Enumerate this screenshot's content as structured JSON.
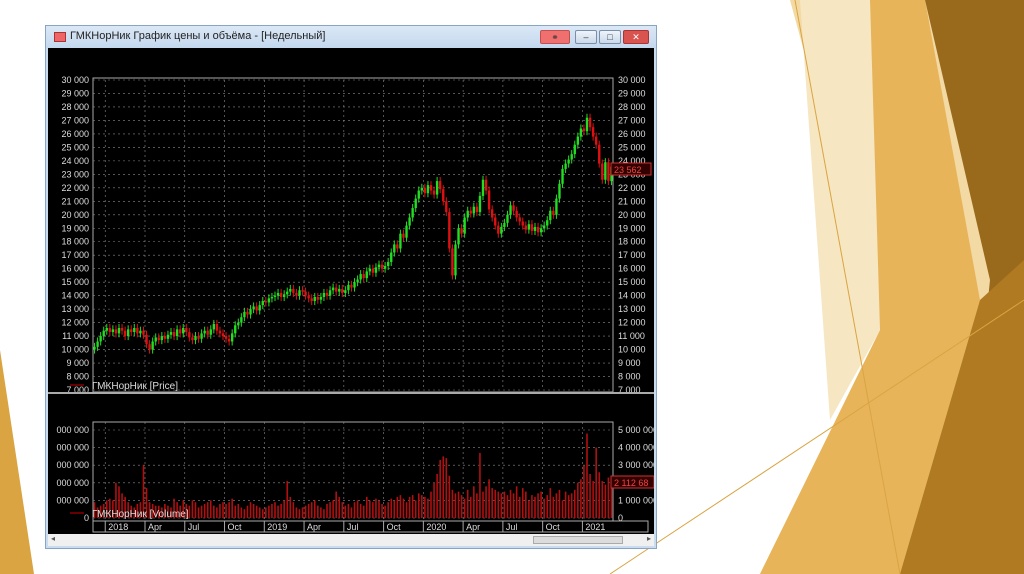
{
  "window": {
    "title": "ГМКНорНик График цены и объёма - [Недельный]",
    "buttons": {
      "link": "link-icon",
      "minimize": "minimize",
      "maximize": "maximize",
      "close": "close"
    }
  },
  "colors": {
    "up": "#22dd22",
    "down": "#dd1111",
    "volume": "#b01010",
    "grid": "#8a8a8a",
    "slide_gold": "#d9a441"
  },
  "price_legend": "ГМКНорНик [Price]",
  "volume_legend": "ГМКНорНик [Volume]",
  "price_last_label": "23 562",
  "volume_last_label": "2 112 68",
  "price_ticks": [
    "7 000",
    "8 000",
    "9 000",
    "10 000",
    "11 000",
    "12 000",
    "13 000",
    "14 000",
    "15 000",
    "16 000",
    "17 000",
    "18 000",
    "19 000",
    "20 000",
    "21 000",
    "22 000",
    "23 000",
    "24 000",
    "25 000",
    "26 000",
    "27 000",
    "28 000",
    "29 000",
    "30 000"
  ],
  "volume_ticks_left": [
    "0",
    "000 000",
    "000 000",
    "000 000",
    "000 000",
    "000 000"
  ],
  "volume_ticks_right": [
    "0",
    "1 000 000",
    "2 000 000",
    "3 000 000",
    "4 000 000",
    "5 000 000"
  ],
  "date_labels": [
    {
      "label": "2018",
      "week": 4
    },
    {
      "label": "Apr",
      "week": 17
    },
    {
      "label": "Jul",
      "week": 30
    },
    {
      "label": "Oct",
      "week": 43
    },
    {
      "label": "2019",
      "week": 56
    },
    {
      "label": "Apr",
      "week": 69
    },
    {
      "label": "Jul",
      "week": 82
    },
    {
      "label": "Oct",
      "week": 95
    },
    {
      "label": "2020",
      "week": 108
    },
    {
      "label": "Apr",
      "week": 121
    },
    {
      "label": "Jul",
      "week": 134
    },
    {
      "label": "Oct",
      "week": 147
    },
    {
      "label": "2021",
      "week": 160
    }
  ],
  "chart_data": [
    {
      "type": "candlestick",
      "interval": "weekly",
      "ylim": [
        7000,
        30000
      ],
      "grid": true,
      "legend": "bottom-left",
      "close": [
        10200,
        10600,
        11000,
        11400,
        11600,
        11300,
        11500,
        11200,
        11600,
        11400,
        11000,
        11500,
        11300,
        11600,
        11200,
        11400,
        11100,
        10400,
        10000,
        10600,
        10900,
        10700,
        11000,
        10800,
        11100,
        11300,
        11000,
        11500,
        11200,
        11600,
        11300,
        10900,
        10700,
        11000,
        10800,
        11200,
        11400,
        11100,
        11500,
        11900,
        11400,
        11200,
        11000,
        10800,
        10600,
        11200,
        11800,
        12000,
        12400,
        12800,
        12600,
        13000,
        13200,
        12900,
        13300,
        13600,
        13500,
        13800,
        13900,
        14000,
        14200,
        13900,
        14100,
        14300,
        14500,
        14200,
        14000,
        14400,
        14300,
        14000,
        13800,
        13600,
        13900,
        13700,
        13900,
        14200,
        14000,
        14400,
        14600,
        14300,
        14500,
        14200,
        14400,
        14800,
        14600,
        15000,
        15200,
        15600,
        15300,
        15800,
        16000,
        15700,
        16100,
        16300,
        16000,
        16200,
        16500,
        17200,
        17800,
        17500,
        18600,
        18300,
        19200,
        19800,
        20500,
        21200,
        21800,
        22000,
        21600,
        22200,
        21800,
        21500,
        22500,
        21900,
        21000,
        20200,
        17500,
        15500,
        17800,
        19000,
        18600,
        19800,
        20300,
        20100,
        20600,
        20200,
        21400,
        22600,
        21800,
        20400,
        19800,
        19200,
        18600,
        19100,
        19400,
        20000,
        20700,
        20300,
        19800,
        19500,
        19200,
        18900,
        19300,
        18800,
        19100,
        18700,
        19000,
        19200,
        19600,
        20300,
        20000,
        21200,
        22300,
        23400,
        23800,
        24100,
        24500,
        25200,
        25800,
        26400,
        26200,
        27200,
        26500,
        25800,
        25200,
        23800,
        22600,
        23900,
        22500,
        23562
      ]
    },
    {
      "type": "bar",
      "series_name": "Volume",
      "ylim": [
        0,
        5000000
      ],
      "values_millions": [
        0.9,
        0.6,
        0.7,
        0.8,
        1.0,
        1.1,
        1.0,
        2.0,
        1.8,
        1.4,
        1.2,
        0.9,
        0.7,
        0.6,
        0.8,
        0.9,
        3.0,
        1.7,
        0.9,
        0.8,
        0.7,
        0.7,
        0.6,
        0.8,
        0.7,
        0.6,
        1.1,
        0.9,
        0.7,
        1.0,
        0.8,
        0.7,
        1.0,
        0.9,
        0.6,
        0.7,
        0.8,
        0.9,
        1.0,
        0.7,
        0.6,
        0.8,
        0.9,
        0.8,
        0.9,
        1.1,
        0.7,
        0.8,
        0.6,
        0.5,
        0.7,
        0.9,
        0.8,
        0.7,
        0.6,
        0.5,
        0.6,
        0.7,
        0.8,
        0.9,
        0.7,
        0.8,
        1.0,
        2.1,
        1.2,
        0.9,
        0.6,
        0.5,
        0.6,
        0.7,
        0.8,
        0.9,
        1.0,
        0.7,
        0.6,
        0.5,
        0.8,
        0.9,
        1.0,
        1.5,
        1.2,
        0.9,
        0.7,
        0.8,
        0.6,
        0.9,
        1.0,
        0.8,
        0.7,
        1.2,
        1.0,
        0.9,
        1.1,
        1.0,
        0.8,
        0.7,
        0.9,
        1.1,
        1.0,
        1.2,
        1.3,
        1.1,
        0.9,
        1.2,
        1.3,
        1.0,
        1.4,
        1.3,
        1.2,
        1.1,
        1.5,
        2.0,
        2.5,
        3.3,
        3.5,
        3.4,
        2.4,
        1.6,
        1.4,
        1.5,
        1.3,
        1.1,
        1.6,
        1.2,
        1.8,
        1.4,
        3.7,
        1.5,
        1.8,
        2.2,
        1.7,
        1.6,
        1.5,
        1.4,
        1.5,
        1.3,
        1.6,
        1.4,
        1.8,
        1.2,
        1.7,
        1.5,
        1.0,
        1.3,
        1.2,
        1.4,
        1.5,
        1.1,
        1.3,
        1.7,
        1.2,
        1.4,
        1.6,
        1.0,
        1.5,
        1.3,
        1.4,
        1.6,
        2.0,
        2.2,
        3.0,
        4.8,
        2.5,
        2.1,
        4.0,
        2.6,
        2.1,
        1.9,
        2.3,
        2.11
      ]
    }
  ]
}
